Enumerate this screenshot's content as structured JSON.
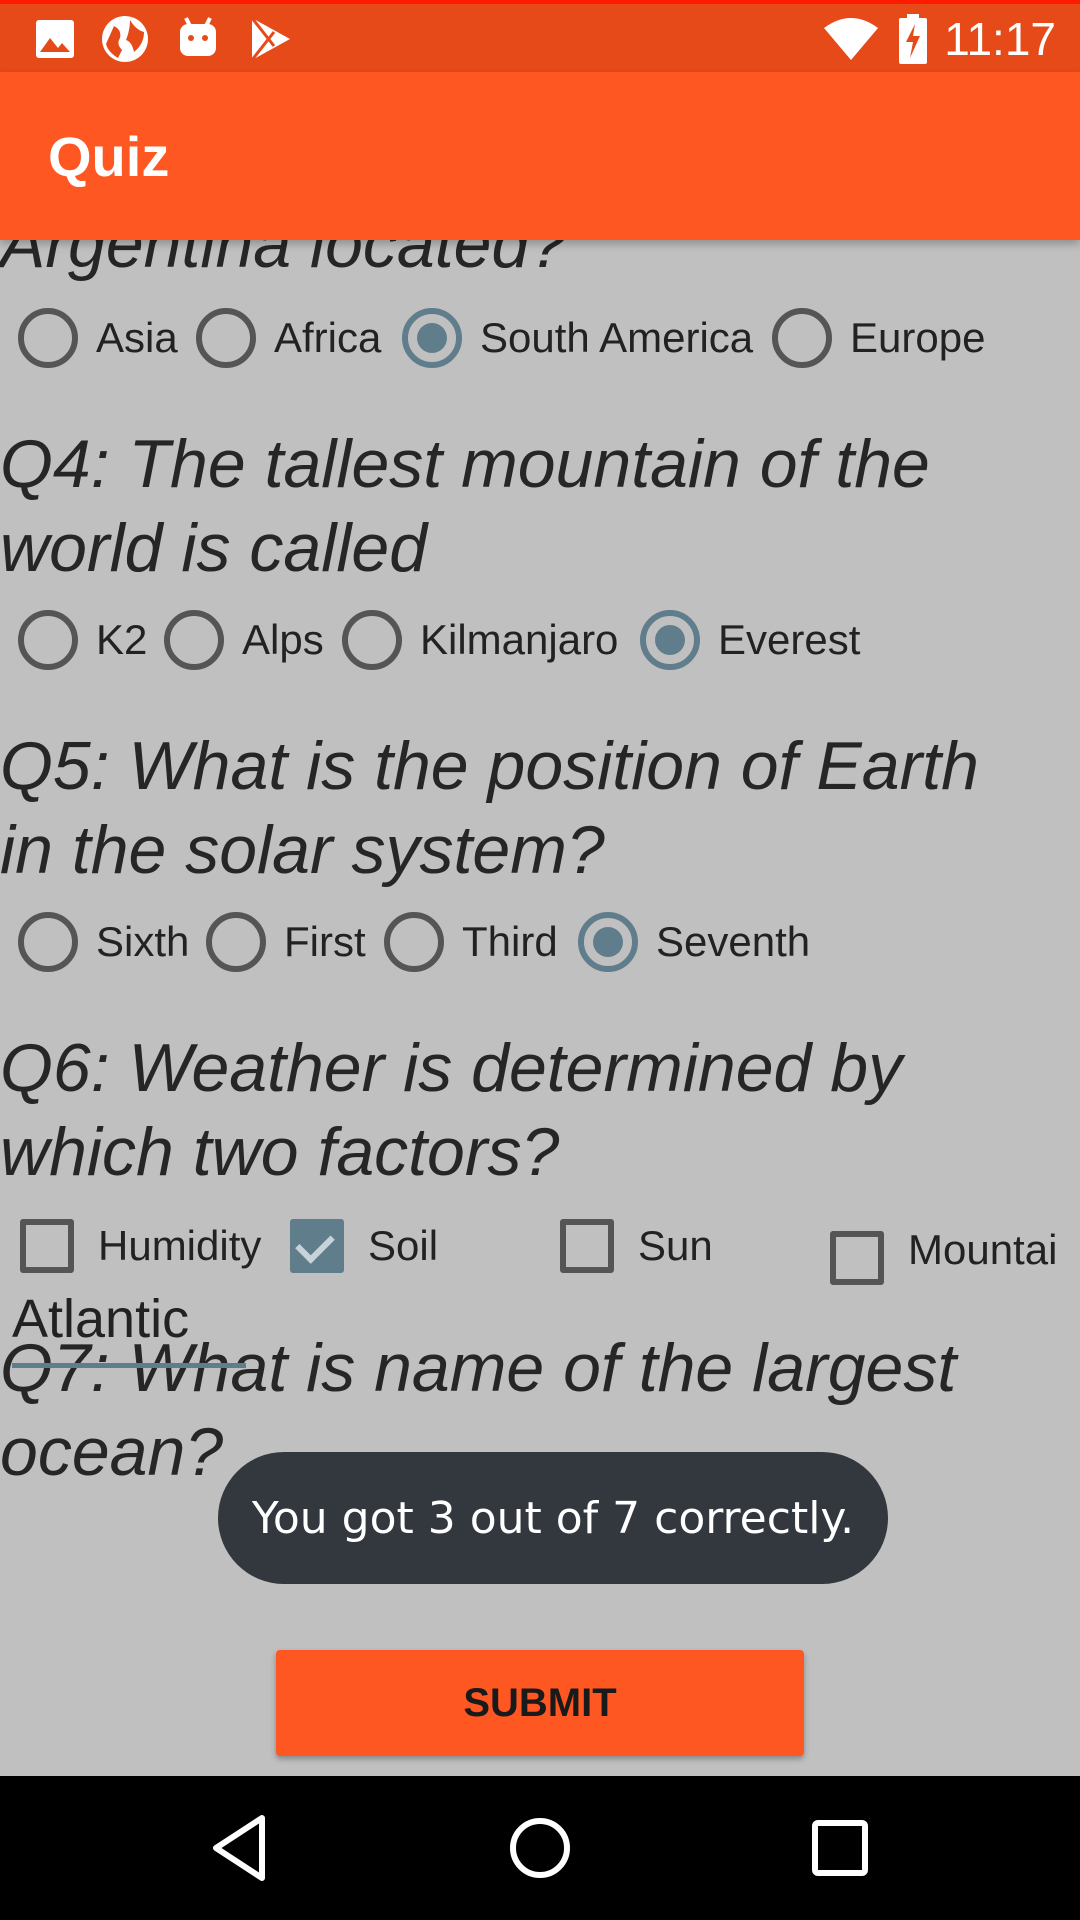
{
  "status_bar": {
    "time": "11:17",
    "icons": [
      "image-icon",
      "globe-icon",
      "android-icon",
      "play-store-icon",
      "wifi-icon",
      "battery-charging-icon"
    ]
  },
  "app_bar": {
    "title": "Quiz"
  },
  "questions": {
    "q3": {
      "partial_text": "Argentina located?",
      "options": [
        "Asia",
        "Africa",
        "South America",
        "Europe"
      ],
      "selected": "South America"
    },
    "q4": {
      "line1": "Q4: The tallest mountain of the",
      "line2": "world is called",
      "options": [
        "K2",
        "Alps",
        "Kilmanjaro",
        "Everest"
      ],
      "selected": "Everest"
    },
    "q5": {
      "line1": "Q5: What is the position of Earth",
      "line2": "in the solar system?",
      "options": [
        "Sixth",
        "First",
        "Third",
        "Seventh"
      ],
      "selected": "Seventh"
    },
    "q6": {
      "line1": "Q6: Weather is determined by",
      "line2": "which two factors?",
      "options": [
        "Humidity",
        "Soil",
        "Sun",
        "Mountai"
      ],
      "checked": [
        "Soil"
      ]
    },
    "q7": {
      "line1": "Q7: What is name of the largest",
      "line2": "ocean?",
      "answer": "Atlantic"
    }
  },
  "submit_label": "SUBMIT",
  "toast": "You got 3 out of 7 correctly.",
  "colors": {
    "primary": "#ff5722",
    "primary_dark": "#e64a19",
    "accent": "#607d8b",
    "background": "#c0c0c0"
  }
}
